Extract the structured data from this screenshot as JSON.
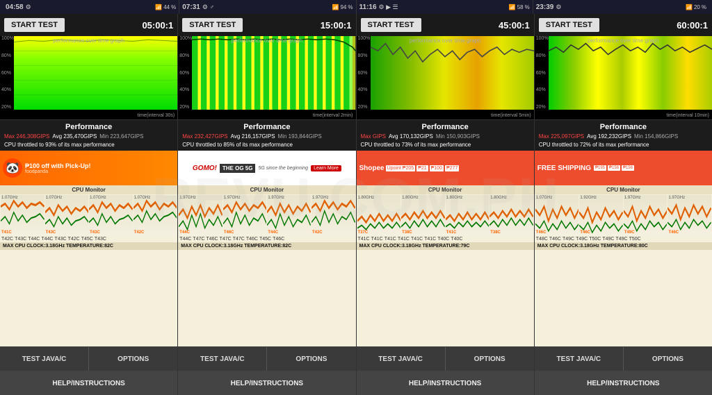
{
  "statusBars": [
    {
      "time": "04:58",
      "icons": "📶 44%",
      "battery": 44
    },
    {
      "time": "07:31",
      "icons": "📶 94%",
      "battery": 94
    },
    {
      "time": "11:16",
      "icons": "📶 58%",
      "battery": 58
    },
    {
      "time": "23:39",
      "icons": "📶 20%",
      "battery": 20
    }
  ],
  "panels": [
    {
      "id": "panel-1",
      "startBtn": "START TEST",
      "timer": "05:00:1",
      "graphLabel": "performance over time graph",
      "graphInterval": "time(interval 30s)",
      "graphType": "full-green",
      "yLabels": [
        "100%",
        "80%",
        "60%",
        "40%",
        "20%"
      ],
      "perfTitle": "Performance",
      "maxStat": "Max 246,308GIPS",
      "avgStat": "Avg 235,470GIPS",
      "minStat": "Min 223,647GIPS",
      "throttleText": "CPU throttled to 93% of its max performance",
      "adType": "panda",
      "adText": "₱100 off with Pick-Up!",
      "cpuMonitorLabel": "CPU Monitor",
      "cpuCores": [
        {
          "label": "1.07GHz",
          "temp": "T41C"
        },
        {
          "label": "1.07GHz",
          "temp": "T43C"
        },
        {
          "label": "1.07GHz",
          "temp": "T43C"
        },
        {
          "label": "1.07GHz",
          "temp": "T42C"
        }
      ],
      "cpuTemps": [
        "T42C",
        "T43C",
        "T44C",
        "T44C",
        "T43C",
        "T42C",
        "T45C",
        "T43C"
      ],
      "cpuFooter": "MAX CPU CLOCK:3.18GHz  TEMPERATURE:82C",
      "btns": [
        "TEST JAVA/C",
        "OPTIONS"
      ],
      "helpBtn": "HELP/INSTRUCTIONS"
    },
    {
      "id": "panel-2",
      "startBtn": "START TEST",
      "timer": "15:00:1",
      "graphLabel": "performance over time graph",
      "graphInterval": "time(interval 2min)",
      "graphType": "striped-green",
      "yLabels": [
        "100%",
        "80%",
        "60%",
        "40%",
        "20%"
      ],
      "perfTitle": "Performance",
      "maxStat": "Max 232,427GIPS",
      "avgStat": "Avg 216,157GIPS",
      "minStat": "Min 193,844GIPS",
      "throttleText": "CPU throttled to 85% of its max performance",
      "adType": "gomo",
      "adText": "THE OG 5G",
      "cpuMonitorLabel": "CPU Monitor",
      "cpuCores": [
        {
          "label": "1.97GHz",
          "temp": "T44C"
        },
        {
          "label": "1.97GHz",
          "temp": "T46C"
        },
        {
          "label": "1.97GHz",
          "temp": "T44C"
        },
        {
          "label": "1.97GHz",
          "temp": "T42C"
        }
      ],
      "cpuTemps": [
        "T44C",
        "T47C",
        "T46C",
        "T47C",
        "T47C",
        "T46C",
        "T45C",
        "T46C"
      ],
      "cpuFooter": "MAX CPU CLOCK:3.18GHz  TEMPERATURE:82C",
      "btns": [
        "TEST JAVA/C",
        "OPTIONS"
      ],
      "helpBtn": "HELP/INSTRUCTIONS"
    },
    {
      "id": "panel-3",
      "startBtn": "START TEST",
      "timer": "45:00:1",
      "graphLabel": "performance over time graph",
      "graphInterval": "time(interval 5min)",
      "graphType": "mixed-yellow",
      "yLabels": [
        "100%",
        "80%",
        "60%",
        "40%",
        "20%"
      ],
      "perfTitle": "Performance",
      "maxStat": "Max GIPS",
      "avgStat": "Avg 170,132GIPS",
      "minStat": "Min 150,903GIPS",
      "throttleText": "CPU throttled to 73% of its max performance",
      "adType": "shopee",
      "adText": "Shopee",
      "cpuMonitorLabel": "CPU Monitor",
      "cpuCores": [
        {
          "label": "1.80GHz",
          "temp": "T37C"
        },
        {
          "label": "1.80GHz",
          "temp": "T38C"
        },
        {
          "label": "1.80GHz",
          "temp": "T41C"
        },
        {
          "label": "1.80GHz",
          "temp": "T38C"
        }
      ],
      "cpuTemps": [
        "T41C",
        "T41C",
        "T41C",
        "T41C",
        "T41C",
        "T41C",
        "T40C",
        "T40C"
      ],
      "cpuFooter": "MAX CPU CLOCK:3.18GHz  TEMPERATURE:79C",
      "btns": [
        "TEST JAVA/C",
        "OPTIONS"
      ],
      "helpBtn": "HELP/INSTRUCTIONS"
    },
    {
      "id": "panel-4",
      "startBtn": "START TEST",
      "timer": "60:00:1",
      "graphLabel": "performance over time graph",
      "graphInterval": "time(interval 10min)",
      "graphType": "mixed-green",
      "yLabels": [
        "100%",
        "80%",
        "60%",
        "40%",
        "20%"
      ],
      "perfTitle": "Performance",
      "maxStat": "Max 225,097GIPS",
      "avgStat": "Avg 192,232GIPS",
      "minStat": "Min 154,866GIPS",
      "throttleText": "CPU throttled to 72% of its max performance",
      "adType": "freeship",
      "adText": "FREE SHIPPING",
      "cpuMonitorLabel": "CPU Monitor",
      "cpuCores": [
        {
          "label": "1.07GHz",
          "temp": "T46C"
        },
        {
          "label": "1.92GHz",
          "temp": "T46C"
        },
        {
          "label": "1.97GHz",
          "temp": "T49C"
        },
        {
          "label": "1.97GHz",
          "temp": "T46C"
        }
      ],
      "cpuTemps": [
        "T48C",
        "T46C",
        "T49C",
        "T49C",
        "T50C",
        "T49C",
        "T49C",
        "T50C"
      ],
      "cpuFooter": "MAX CPU CLOCK:3.18GHz  TEMPERATURE:80C",
      "btns": [
        "TEST JAVA/C",
        "OPTIONS"
      ],
      "helpBtn": "HELP/INSTRUCTIONS"
    }
  ],
  "watermark": "REVU.COM.PH"
}
